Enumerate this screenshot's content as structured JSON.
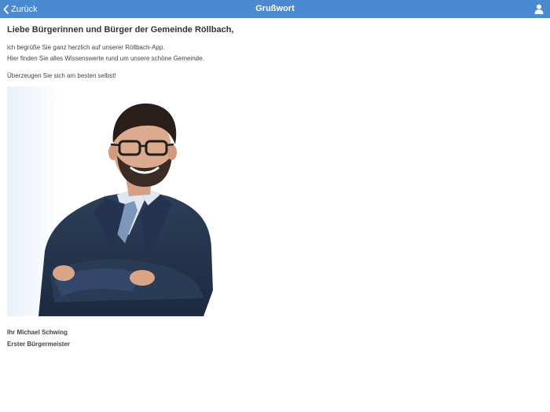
{
  "navbar": {
    "back_label": "Zurück",
    "title": "Grußwort",
    "background": "#4a8ad0",
    "back_icon": "chevron-left-icon",
    "profile_icon": "person-icon"
  },
  "content": {
    "greeting": "Liebe Bürgerinnen und Bürger der Gemeinde Röllbach,",
    "paragraph_1": "ich begrüße Sie ganz herzlich auf unserer Röllbach-App.",
    "paragraph_2": "Hier finden Sie alles Wissenswerte rund um unsere schöne Gemeinde.",
    "paragraph_3": "Überzeugen Sie sich am besten selbst!",
    "signature_name": "Ihr Michael Schwing",
    "signature_title": "Erster Bürgermeister"
  }
}
